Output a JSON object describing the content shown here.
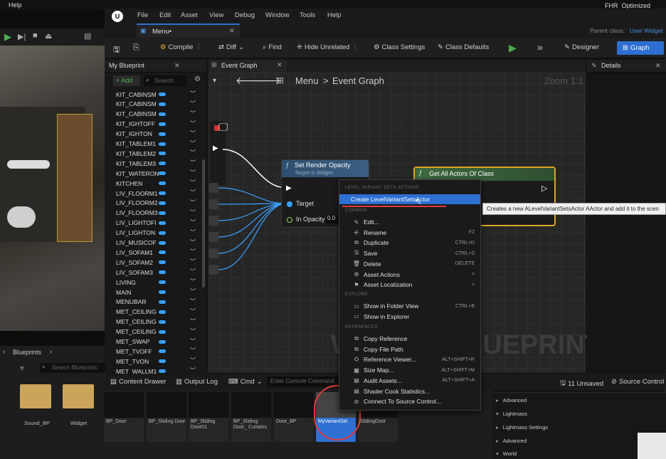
{
  "top_menu": {
    "help": "Help",
    "project": "FHR_Optimized"
  },
  "menubar": {
    "items": [
      "File",
      "Edit",
      "Asset",
      "View",
      "Debug",
      "Window",
      "Tools",
      "Help"
    ]
  },
  "tab": {
    "label": "Menu•",
    "parent_class_label": "Parent class:",
    "parent_class_value": "User Widget"
  },
  "toolbar": {
    "compile": "Compile",
    "diff": "Diff",
    "find": "Find",
    "hide_unrelated": "Hide Unrelated",
    "class_settings": "Class Settings",
    "class_defaults": "Class Defaults",
    "designer": "Designer",
    "graph": "Graph"
  },
  "my_blueprint": {
    "title": "My Blueprint",
    "add": "+ Add",
    "search_placeholder": "Search",
    "variables": [
      "KIT_CABINSM",
      "KIT_CABINSM",
      "KIT_CABINSM",
      "KIT_IGHTOFF",
      "KIT_IGHTON",
      "KIT_TABLEM1",
      "KIT_TABLEM2",
      "KIT_TABLEM3",
      "KIT_WATERON",
      "KITCHEN",
      "LIV_FLOORM1",
      "LIV_FLOORM2",
      "LIV_FLOORM3",
      "LIV_LIGHTOFI",
      "LIV_LIGHTON",
      "LIV_MUSICOF",
      "LIV_SOFAM1",
      "LIV_SOFAM2",
      "LIV_SOFAM3",
      "LIVING",
      "MAIN",
      "MENUBAR",
      "MET_CEILING",
      "MET_CEILING",
      "MET_CEILING",
      "MET_SWAP",
      "MET_TVOFF",
      "MET_TVON",
      "MET_WALLM1"
    ]
  },
  "graph": {
    "tab": "Event Graph",
    "breadcrumb_root": "Menu",
    "breadcrumb_sep": ">",
    "breadcrumb_leaf": "Event Graph",
    "zoom": "Zoom 1:1",
    "watermark": "WIDGET BLUEPRINT",
    "node_render": {
      "title": "Set Render Opacity",
      "subtitle": "Target is Widget",
      "target": "Target",
      "opacity": "In Opacity",
      "opacity_value": "0.0"
    },
    "node_actors": {
      "title": "Get All Actors Of Class"
    }
  },
  "details": {
    "title": "Details"
  },
  "context_menu": {
    "section_level": "LEVEL VARIANT SETS ACTIONS",
    "create": "Create LevelVariantSetsActor",
    "section_common": "COMMON",
    "common": [
      {
        "label": "Edit...",
        "shortcut": ""
      },
      {
        "label": "Rename",
        "shortcut": "F2"
      },
      {
        "label": "Duplicate",
        "shortcut": "CTRL+D"
      },
      {
        "label": "Save",
        "shortcut": "CTRL+S"
      },
      {
        "label": "Delete",
        "shortcut": "DELETE"
      },
      {
        "label": "Asset Actions",
        "shortcut": ">"
      },
      {
        "label": "Asset Localization",
        "shortcut": ">"
      }
    ],
    "section_explore": "EXPLORE",
    "explore": [
      {
        "label": "Show in Folder View",
        "shortcut": "CTRL+B"
      },
      {
        "label": "Show in Explorer",
        "shortcut": ""
      }
    ],
    "section_refs": "REFERENCES",
    "refs": [
      {
        "label": "Copy Reference",
        "shortcut": ""
      },
      {
        "label": "Copy File Path",
        "shortcut": ""
      },
      {
        "label": "Reference Viewer...",
        "shortcut": "ALT+SHIFT+R"
      },
      {
        "label": "Size Map...",
        "shortcut": "ALT+SHIFT+M"
      },
      {
        "label": "Audit Assets...",
        "shortcut": "ALT+SHIFT+A"
      },
      {
        "label": "Shader Cook Statistics...",
        "shortcut": ""
      },
      {
        "label": "Connect To Source Control...",
        "shortcut": ""
      }
    ]
  },
  "tooltip": "Creates a new ALevelVariantSetsActor AActor and add it to the scen",
  "bottombar": {
    "content_drawer": "Content Drawer",
    "output_log": "Output Log",
    "cmd": "Cmd",
    "console_placeholder": "Enter Console Command",
    "unsaved": "11 Unsaved",
    "source_control": "Source Control"
  },
  "content": {
    "path": "Blueprints",
    "search_placeholder": "Search Blueprints",
    "folders": [
      "Sound_BP",
      "Widget"
    ],
    "assets": [
      "BP_Door",
      "BP_Sliding Door",
      "BP_Sliding Door01",
      "BP_Sliding Door_ Curtains",
      "Door_BP",
      "MyVariantSet",
      "SlidingDoor"
    ]
  },
  "props": [
    "Advanced",
    "Lightmass",
    "Lightmass Settings",
    "Advanced",
    "World"
  ]
}
